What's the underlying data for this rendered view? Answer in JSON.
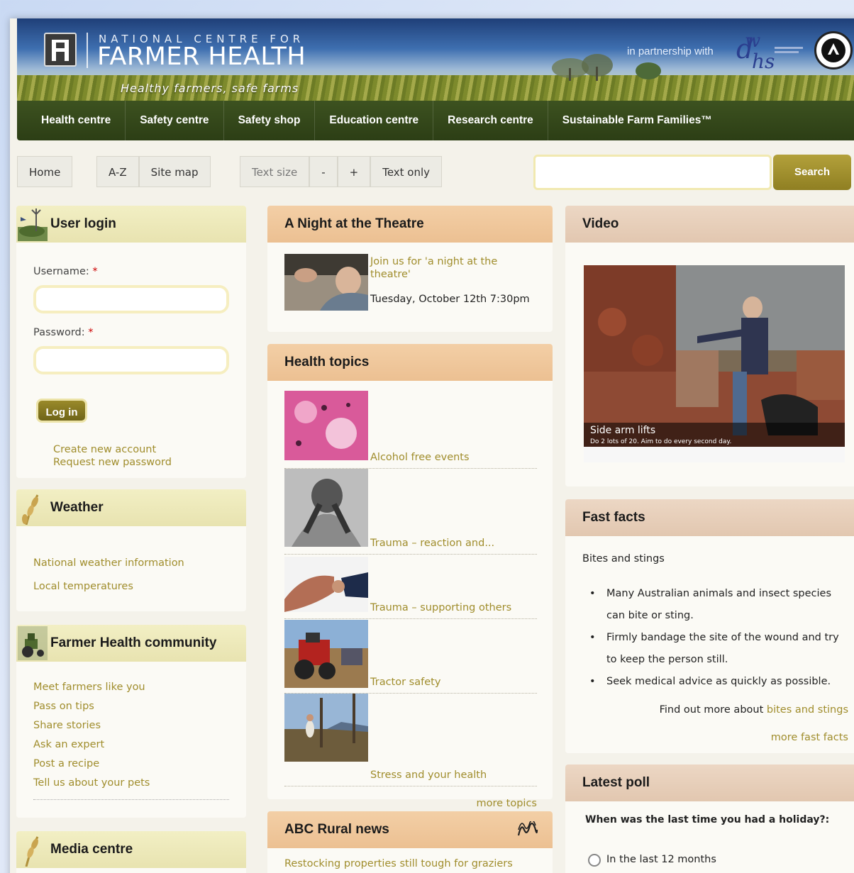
{
  "header": {
    "brand_top": "NATIONAL CENTRE FOR",
    "brand_main": "FARMER HEALTH",
    "tagline": "Healthy farmers, safe farms",
    "partner_text": "in partnership with"
  },
  "nav": {
    "items": [
      "Health centre",
      "Safety centre",
      "Safety shop",
      "Education centre",
      "Research centre",
      "Sustainable Farm Families™"
    ]
  },
  "toolbar": {
    "home": "Home",
    "az": "A-Z",
    "sitemap": "Site map",
    "text_size": "Text size",
    "minus": "-",
    "plus": "+",
    "text_only": "Text only",
    "search_button": "Search",
    "search_placeholder": ""
  },
  "login": {
    "title": "User login",
    "username_label": "Username: ",
    "password_label": "Password: ",
    "required_mark": "*",
    "login_button": "Log in",
    "create_account": "Create new account",
    "request_password": "Request new password"
  },
  "weather": {
    "title": "Weather",
    "links": [
      "National weather information",
      "Local temperatures"
    ]
  },
  "community": {
    "title": "Farmer Health community",
    "links": [
      "Meet farmers like you",
      "Pass on tips",
      "Share stories",
      "Ask an expert",
      "Post a recipe",
      "Tell us about your pets"
    ]
  },
  "media": {
    "title": "Media centre"
  },
  "theatre": {
    "title": "A Night at the Theatre",
    "link": "Join us for 'a night at the theatre'",
    "datetime": "Tuesday, October 12th 7:30pm"
  },
  "health_topics": {
    "title": "Health topics",
    "items": [
      "Alcohol free events",
      "Trauma – reaction and...",
      "Trauma – supporting others",
      "Tractor safety",
      "Stress and your health"
    ],
    "more": "more topics"
  },
  "abc": {
    "title": "ABC Rural news",
    "headline": "Restocking properties still tough for graziers"
  },
  "video": {
    "title": "Video",
    "caption_title": "Side arm lifts",
    "caption_sub": "Do 2 lots of 20. Aim to do every second day."
  },
  "fast_facts": {
    "title": "Fast facts",
    "subtitle": "Bites and stings",
    "bullets": [
      "Many Australian animals and insect species can bite or sting.",
      "Firmly bandage the site of the wound and try to keep the person still.",
      "Seek medical advice as quickly as possible."
    ],
    "find_out_prefix": "Find out more about ",
    "find_out_link": "bites and stings",
    "more": "more fast facts"
  },
  "poll": {
    "title": "Latest poll",
    "question": "When was the last time you had a holiday?:",
    "options": [
      "In the last 12 months"
    ]
  },
  "colors": {
    "nav_bg": "#2c3e15",
    "link": "#a08d2c",
    "search_btn": "#a4922f"
  },
  "icons": [
    "search-icon",
    "windmill-icon",
    "wheat-icon",
    "tractor-icon",
    "abc-logo-icon"
  ]
}
